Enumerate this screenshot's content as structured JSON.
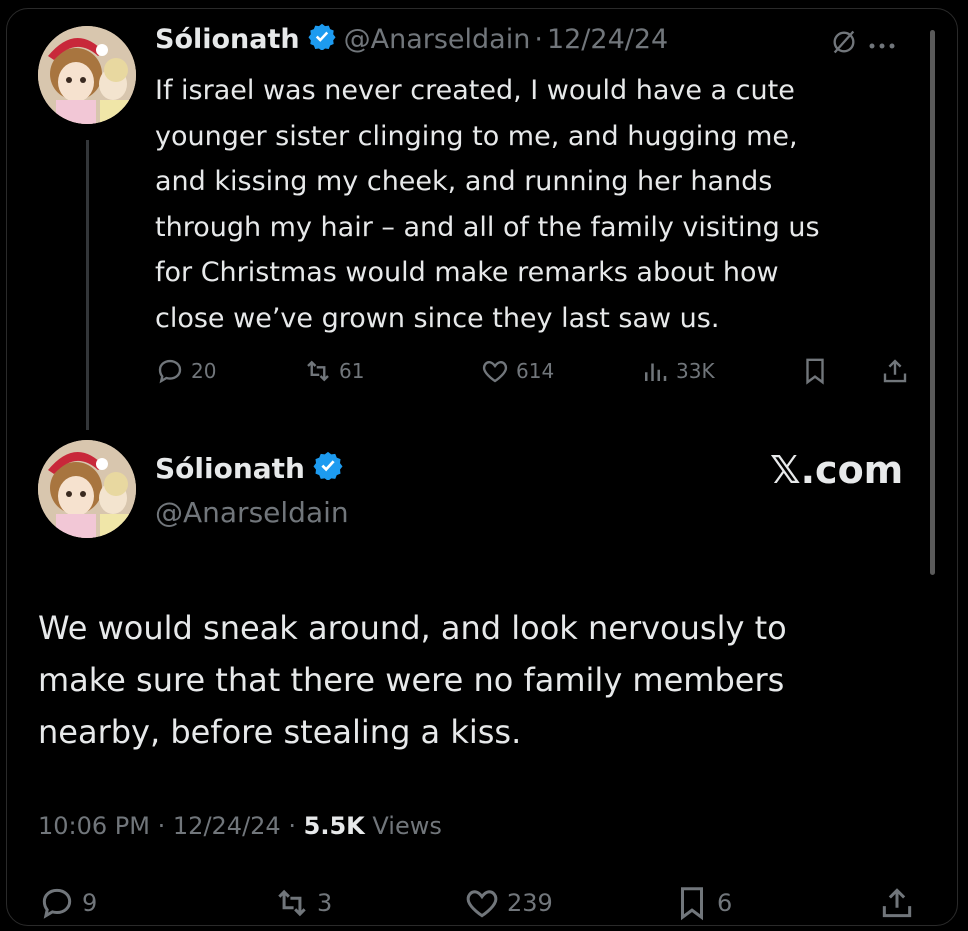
{
  "colors": {
    "background": "#000000",
    "text": "#e7e9ea",
    "muted": "#71767b",
    "verified": "#1d9bf0"
  },
  "quoted_post": {
    "display_name": "Sólionath",
    "handle": "@Anarseldain",
    "separator": "·",
    "date": "12/24/24",
    "text": "If israel was never created, I would have a cute\nyounger sister clinging to me, and hugging me,\nand kissing my cheek, and running her hands\nthrough my hair – and all of the family visiting us\nfor Christmas would make remarks about how\nclose we’ve grown since they last saw us.",
    "replies": "20",
    "reposts": "61",
    "likes": "614",
    "views": "33K",
    "icons": [
      "grok-icon",
      "more-icon",
      "reply-icon",
      "repost-icon",
      "like-icon",
      "views-icon",
      "bookmark-icon",
      "share-icon"
    ]
  },
  "main_post": {
    "display_name": "Sólionath",
    "handle": "@Anarseldain",
    "site_label": "𝕏.com",
    "text": "We would sneak around, and look nervously to\nmake sure that there were no family members\nnearby, before stealing a kiss.",
    "time": "10:06 PM",
    "separator": "·",
    "date": "12/24/24",
    "views_count": "5.5K",
    "views_label": "Views",
    "replies": "9",
    "reposts": "3",
    "likes": "239",
    "bookmarks": "6"
  }
}
